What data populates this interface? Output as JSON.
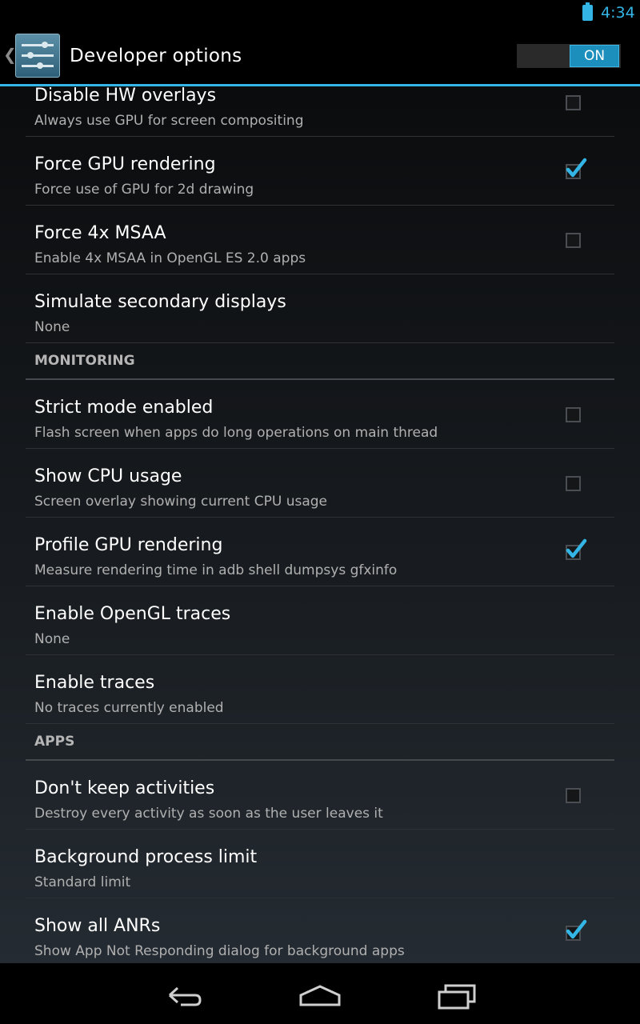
{
  "status_bar": {
    "time": "4:34",
    "battery_icon": "battery-icon"
  },
  "action_bar": {
    "title": "Developer options",
    "switch_label": "ON",
    "accent_color": "#33b5e5"
  },
  "items": [
    {
      "title": "Disable HW overlays",
      "summary": "Always use GPU for screen compositing",
      "checkbox": true,
      "checked": false
    },
    {
      "title": "Force GPU rendering",
      "summary": "Force use of GPU for 2d drawing",
      "checkbox": true,
      "checked": true
    },
    {
      "title": "Force 4x MSAA",
      "summary": "Enable 4x MSAA in OpenGL ES 2.0 apps",
      "checkbox": true,
      "checked": false
    },
    {
      "title": "Simulate secondary displays",
      "summary": "None",
      "checkbox": false
    }
  ],
  "monitoring": {
    "header": "MONITORING",
    "items": [
      {
        "title": "Strict mode enabled",
        "summary": "Flash screen when apps do long operations on main thread",
        "checkbox": true,
        "checked": false
      },
      {
        "title": "Show CPU usage",
        "summary": "Screen overlay showing current CPU usage",
        "checkbox": true,
        "checked": false
      },
      {
        "title": "Profile GPU rendering",
        "summary": "Measure rendering time in adb shell dumpsys gfxinfo",
        "checkbox": true,
        "checked": true
      },
      {
        "title": "Enable OpenGL traces",
        "summary": "None",
        "checkbox": false
      },
      {
        "title": "Enable traces",
        "summary": "No traces currently enabled",
        "checkbox": false
      }
    ]
  },
  "apps": {
    "header": "APPS",
    "items": [
      {
        "title": "Don't keep activities",
        "summary": "Destroy every activity as soon as the user leaves it",
        "checkbox": true,
        "checked": false
      },
      {
        "title": "Background process limit",
        "summary": "Standard limit",
        "checkbox": false
      },
      {
        "title": "Show all ANRs",
        "summary": "Show App Not Responding dialog for background apps",
        "checkbox": true,
        "checked": true
      }
    ]
  },
  "nav_bar": {
    "icons": [
      "back-icon",
      "home-icon",
      "recent-apps-icon"
    ]
  }
}
